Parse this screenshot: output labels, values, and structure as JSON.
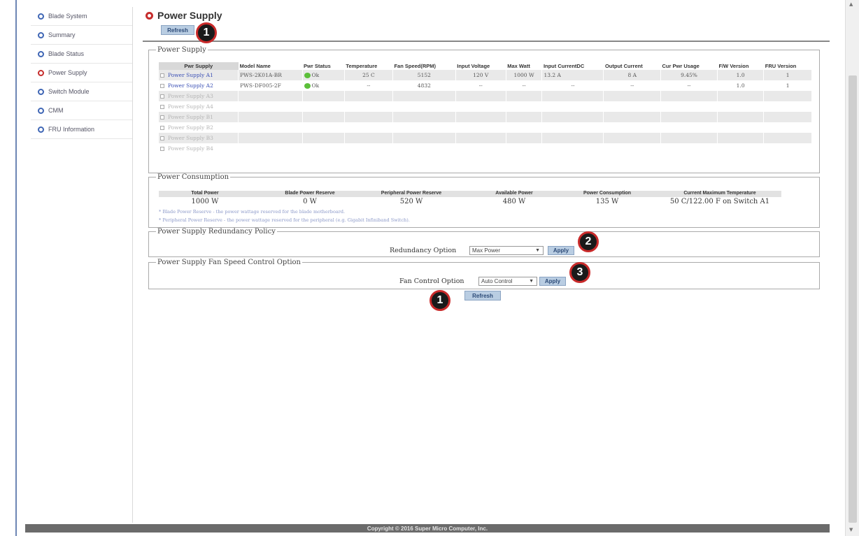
{
  "sidebar": {
    "items": [
      {
        "label": "Blade System",
        "color": "#3f66b5"
      },
      {
        "label": "Summary",
        "color": "#3f66b5"
      },
      {
        "label": "Blade Status",
        "color": "#3f66b5"
      },
      {
        "label": "Power Supply",
        "color": "#c62d2d",
        "active": true
      },
      {
        "label": "Switch Module",
        "color": "#3f66b5"
      },
      {
        "label": "CMM",
        "color": "#3f66b5"
      },
      {
        "label": "FRU Information",
        "color": "#3f66b5"
      }
    ]
  },
  "page": {
    "title": "Power Supply",
    "refresh_label": "Refresh"
  },
  "power_supply": {
    "legend": "Power Supply",
    "columns": [
      "Pwr Supply",
      "Model Name",
      "Pwr Status",
      "Temperature",
      "Fan Speed(RPM)",
      "Input Voltage",
      "Max Watt",
      "Input CurrentDC",
      "Output Current",
      "Cur Pwr Usage",
      "F/W Version",
      "FRU Version"
    ],
    "rows": [
      {
        "name": "Power Supply A1",
        "model": "PWS-2K01A-BR",
        "status": "Ok",
        "temp": "25 C",
        "fan": "5152",
        "input_v": "120 V",
        "max_w": "1000 W",
        "input_c": "13.2 A",
        "output_c": "8 A",
        "usage": "9.45%",
        "fw": "1.0",
        "fru": "1",
        "active": true
      },
      {
        "name": "Power Supply A2",
        "model": "PWS-DF005-2F",
        "status": "Ok",
        "temp": "--",
        "fan": "4832",
        "input_v": "--",
        "max_w": "--",
        "input_c": "--",
        "output_c": "--",
        "usage": "--",
        "fw": "1.0",
        "fru": "1",
        "active": true
      },
      {
        "name": "Power Supply A3",
        "active": false
      },
      {
        "name": "Power Supply A4",
        "active": false
      },
      {
        "name": "Power Supply B1",
        "active": false
      },
      {
        "name": "Power Supply B2",
        "active": false
      },
      {
        "name": "Power Supply B3",
        "active": false
      },
      {
        "name": "Power Supply B4",
        "active": false
      }
    ]
  },
  "consumption": {
    "legend": "Power Consumption",
    "headers": [
      "Total Power",
      "Blade Power Reserve",
      "Peripheral Power Reserve",
      "Available Power",
      "Power Consumption",
      "Current Maximum Temperature"
    ],
    "values": [
      "1000 W",
      "0 W",
      "520 W",
      "480 W",
      "135 W",
      "50 C/122.00 F on Switch A1"
    ],
    "notes": [
      "* Blade Power Reserve - the power wattage reserved for the blade motherboard.",
      "* Peripheral Power Reserve - the power wattage reserved for the peripheral (e.g. Gigabit Infiniband Switch)."
    ]
  },
  "redundancy": {
    "legend": "Power Supply Redundancy Policy",
    "label": "Redundancy Option",
    "value": "Max Power",
    "apply_label": "Apply"
  },
  "fan_control": {
    "legend": "Power Supply Fan Speed Control Option",
    "label": "Fan Control Option",
    "value": "Auto Control",
    "apply_label": "Apply"
  },
  "markers": [
    "1",
    "1",
    "2",
    "3"
  ],
  "footer": "Copyright © 2016 Super Micro Computer, Inc."
}
